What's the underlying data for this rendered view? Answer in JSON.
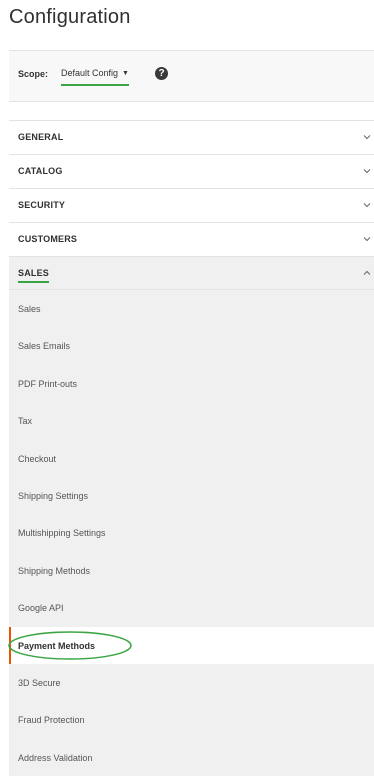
{
  "page": {
    "title": "Configuration"
  },
  "scope": {
    "label": "Scope:",
    "value": "Default Config",
    "help_icon": "question-circle-icon"
  },
  "sections": [
    {
      "label": "GENERAL",
      "state": "collapsed"
    },
    {
      "label": "CATALOG",
      "state": "collapsed"
    },
    {
      "label": "SECURITY",
      "state": "collapsed"
    },
    {
      "label": "CUSTOMERS",
      "state": "collapsed"
    },
    {
      "label": "SALES",
      "state": "expanded"
    }
  ],
  "sales_items": [
    {
      "label": "Sales"
    },
    {
      "label": "Sales Emails"
    },
    {
      "label": "PDF Print-outs"
    },
    {
      "label": "Tax"
    },
    {
      "label": "Checkout"
    },
    {
      "label": "Shipping Settings"
    },
    {
      "label": "Multishipping Settings"
    },
    {
      "label": "Shipping Methods"
    },
    {
      "label": "Google API"
    },
    {
      "label": "Payment Methods",
      "active": true
    },
    {
      "label": "3D Secure"
    },
    {
      "label": "Fraud Protection"
    },
    {
      "label": "Address Validation"
    }
  ],
  "colors": {
    "accent_underline": "#3aa542",
    "active_marker": "#eb5202",
    "open_section_bg": "#f0f0f0"
  }
}
